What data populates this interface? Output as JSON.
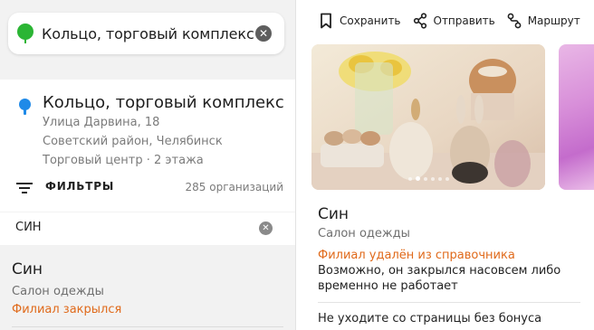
{
  "search": {
    "query": "Кольцо, торговый комплекс"
  },
  "place": {
    "title": "Кольцо, торговый комплекс",
    "street": "Улица Дарвина, 18",
    "district": "Советский район, Челябинск",
    "type": "Торговый центр · 2 этажа",
    "filters_label": "ФИЛЬТРЫ",
    "org_count": "285 организаций"
  },
  "inside_search": {
    "query": "СИН"
  },
  "results": [
    {
      "name": "Син",
      "category": "Салон одежды",
      "status": "Филиал закрылся"
    }
  ],
  "card": {
    "actions": [
      {
        "label": "Сохранить",
        "icon": "bookmark-icon"
      },
      {
        "label": "Отправить",
        "icon": "share-icon"
      },
      {
        "label": "Маршрут",
        "icon": "route-icon"
      }
    ],
    "photo_count": 6,
    "photo_active": 1,
    "name": "Син",
    "category": "Салон одежды",
    "status": "Филиал удалён из справочника",
    "description_line1": "Возможно, он закрылся насовсем либо",
    "description_line2": "временно не работает",
    "bonus_text": "Не уходите со страницы без бонуса"
  },
  "colors": {
    "closed_status": "#e06a1b",
    "pin_green": "#2bb534",
    "pin_blue": "#1f8ae8"
  }
}
